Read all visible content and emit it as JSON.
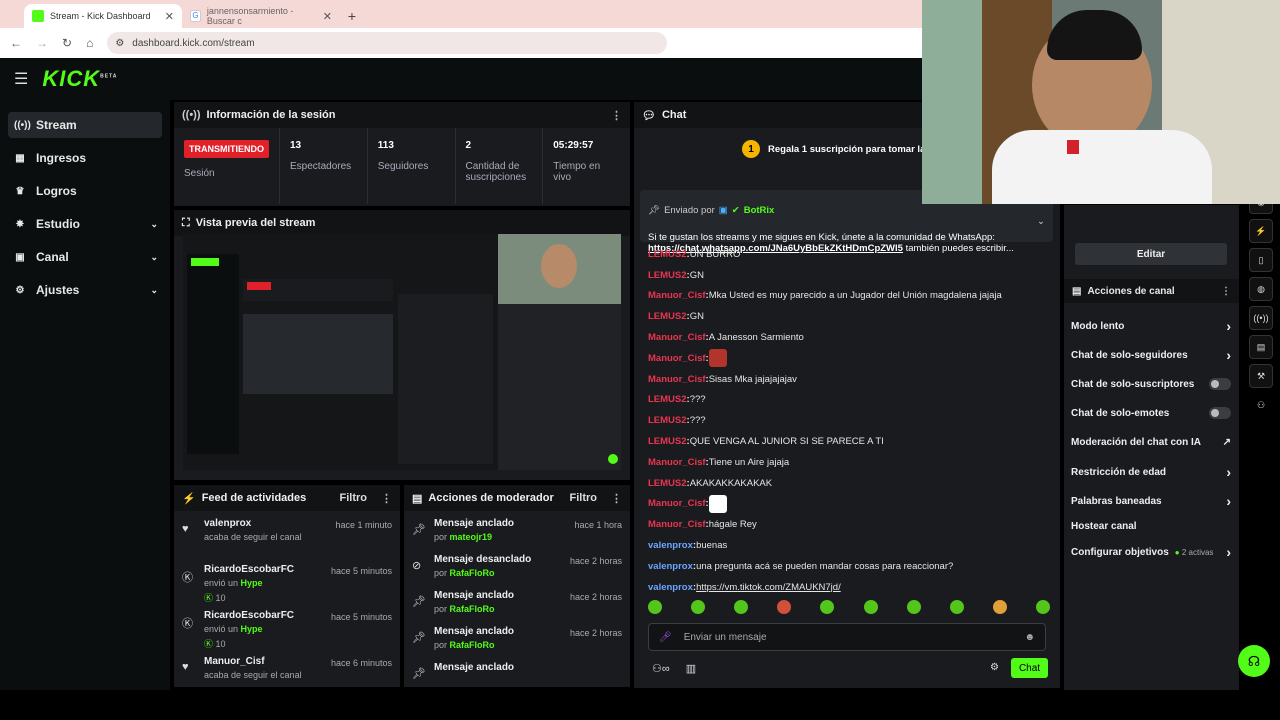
{
  "browser": {
    "tabs": [
      {
        "title": "Stream - Kick Dashboard",
        "active": true
      },
      {
        "title": "jannensonsarmiento - Buscar c",
        "active": false
      }
    ],
    "url": "dashboard.kick.com/stream"
  },
  "brand": {
    "logo": "KICK",
    "beta": "BETA"
  },
  "sidebar": {
    "items": [
      {
        "label": "Stream",
        "icon": "stream-icon",
        "active": true
      },
      {
        "label": "Ingresos",
        "icon": "revenue-icon"
      },
      {
        "label": "Logros",
        "icon": "trophy-icon"
      },
      {
        "label": "Estudio",
        "icon": "studio-icon",
        "expandable": true
      },
      {
        "label": "Canal",
        "icon": "channel-icon",
        "expandable": true
      },
      {
        "label": "Ajustes",
        "icon": "gear-icon",
        "expandable": true
      }
    ]
  },
  "session": {
    "title": "Información de la sesión",
    "status": "TRANSMITIENDO",
    "session_label": "Sesión",
    "stats": [
      {
        "value": "13",
        "label": "Espectadores"
      },
      {
        "value": "113",
        "label": "Seguidores"
      },
      {
        "value": "2",
        "label": "Cantidad de suscripciones"
      },
      {
        "value": "05:29:57",
        "label": "Tiempo en vivo"
      }
    ]
  },
  "preview": {
    "title": "Vista previa del stream"
  },
  "feed": {
    "title": "Feed de actividades",
    "filter": "Filtro",
    "items": [
      {
        "name": "valenprox",
        "detail": "acaba de seguir el canal",
        "time": "hace 1 minuto",
        "icon": "heart-icon"
      },
      {
        "name": "RicardoEscobarFC",
        "detail_prefix": "envió un",
        "detail_highlight": "Hype",
        "amount": "10",
        "time": "hace 5 minutos",
        "icon": "kick-icon"
      },
      {
        "name": "RicardoEscobarFC",
        "detail_prefix": "envió un",
        "detail_highlight": "Hype",
        "amount": "10",
        "time": "hace 5 minutos",
        "icon": "kick-icon"
      },
      {
        "name": "Manuor_Cisf",
        "detail": "acaba de seguir el canal",
        "time": "hace 6 minutos",
        "icon": "heart-icon"
      }
    ]
  },
  "moderator": {
    "title": "Acciones de moderador",
    "filter": "Filtro",
    "items": [
      {
        "action": "Mensaje anclado",
        "by_prefix": "por",
        "by": "mateojr19",
        "time": "hace 1 hora",
        "icon": "pin-icon"
      },
      {
        "action": "Mensaje desanclado",
        "by_prefix": "por",
        "by": "RafaFloRo",
        "time": "hace 2 horas",
        "icon": "unpin-icon"
      },
      {
        "action": "Mensaje anclado",
        "by_prefix": "por",
        "by": "RafaFloRo",
        "time": "hace 2 horas",
        "icon": "pin-icon"
      },
      {
        "action": "Mensaje anclado",
        "by_prefix": "por",
        "by": "RafaFloRo",
        "time": "hace 2 horas",
        "icon": "pin-icon"
      },
      {
        "action": "Mensaje anclado",
        "by_prefix": "",
        "by": "",
        "time": "",
        "icon": "pin-icon"
      }
    ]
  },
  "chat": {
    "title": "Chat",
    "gift_banner": "Regala 1 suscripción para tomar la po",
    "gift_rank": "1",
    "pinned": {
      "sent_by_label": "Enviado por",
      "sender": "BotRix",
      "text": "Si te gustan los streams y me sigues en Kick, únete a la comunidad de WhatsApp:",
      "link": "https://chat.whatsapp.com/JNa6UyBbEkZKtHDmCpZWl5",
      "suffix": "también puedes escribir..."
    },
    "messages": [
      {
        "user": "LEMUS2",
        "text": "UN BURRO",
        "color": "#e8364f"
      },
      {
        "user": "LEMUS2",
        "text": "GN",
        "color": "#e8364f"
      },
      {
        "user": "Manuor_Cisf",
        "text": "Mka Usted es muy parecido a un Jugador del Unión magdalena jajaja",
        "color": "#e8364f"
      },
      {
        "user": "LEMUS2",
        "text": "GN",
        "color": "#e8364f"
      },
      {
        "user": "Manuor_Cisf",
        "text": "A Janesson Sarmiento",
        "color": "#e8364f"
      },
      {
        "user": "Manuor_Cisf",
        "text": "",
        "color": "#e8364f",
        "emote": "red-face-emote"
      },
      {
        "user": "Manuor_Cisf",
        "text": "Sisas Mka jajajajajav",
        "color": "#e8364f"
      },
      {
        "user": "LEMUS2",
        "text": "???",
        "color": "#e8364f"
      },
      {
        "user": "LEMUS2",
        "text": "???",
        "color": "#e8364f"
      },
      {
        "user": "LEMUS2",
        "text": "QUE VENGA AL JUNIOR SI SE PARECE A TI",
        "color": "#e8364f"
      },
      {
        "user": "Manuor_Cisf",
        "text": "Tiene un Aire jajaja",
        "color": "#e8364f"
      },
      {
        "user": "LEMUS2",
        "text": "AKAKAKKAKAKAK",
        "color": "#e8364f"
      },
      {
        "user": "Manuor_Cisf",
        "text": "",
        "color": "#e8364f",
        "emote": "shield-emote"
      },
      {
        "user": "Manuor_Cisf",
        "text": "hágale Rey",
        "color": "#e8364f"
      },
      {
        "user": "valenprox",
        "text": "buenas",
        "color": "#6aa6ff"
      },
      {
        "user": "valenprox",
        "text": "una pregunta acá se pueden mandar cosas para reaccionar?",
        "color": "#6aa6ff"
      },
      {
        "user": "valenprox",
        "text": "https://vm.tiktok.com/ZMAUKN7jd/",
        "color": "#6aa6ff",
        "link": true
      }
    ],
    "input_placeholder": "Enviar un mensaje",
    "send_label": "Chat"
  },
  "channel_actions": {
    "edit_label": "Editar",
    "title": "Acciones de canal",
    "items": [
      {
        "label": "Modo lento",
        "control": "chevron"
      },
      {
        "label": "Chat de solo-seguidores",
        "control": "chevron"
      },
      {
        "label": "Chat de solo-suscriptores",
        "control": "toggle"
      },
      {
        "label": "Chat de solo-emotes",
        "control": "toggle"
      },
      {
        "label": "Moderación del chat con IA",
        "control": "chart"
      },
      {
        "label": "Restricción de edad",
        "control": "chevron"
      },
      {
        "label": "Palabras baneadas",
        "control": "chevron"
      },
      {
        "label": "Hostear canal",
        "control": "none"
      },
      {
        "label": "Configurar objetivos",
        "control": "chevron",
        "badge": "2 activas"
      }
    ]
  },
  "colors": {
    "accent": "#53fc18",
    "live": "#e1212a",
    "panel": "#191b1f"
  }
}
